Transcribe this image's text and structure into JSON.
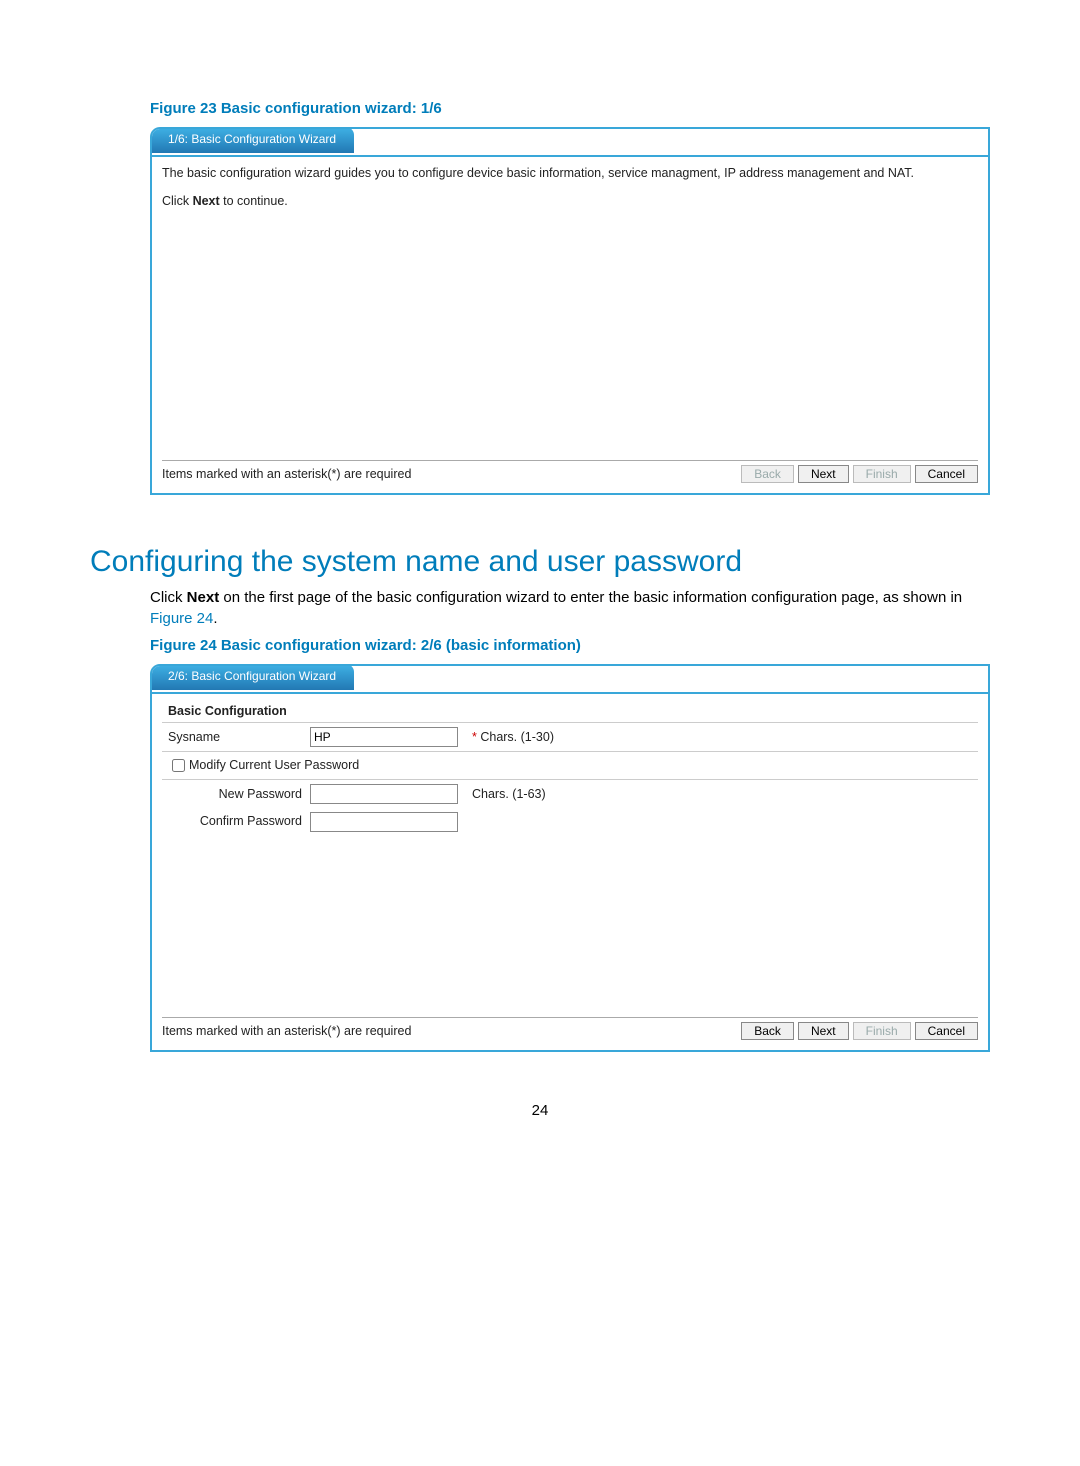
{
  "fig23": {
    "caption": "Figure 23 Basic configuration wizard: 1/6",
    "tab": "1/6: Basic Configuration Wizard",
    "intro": "The basic configuration wizard guides you to configure device basic information, service managment, IP address management and NAT.",
    "cont_pre": "Click ",
    "cont_bold": "Next",
    "cont_post": " to continue.",
    "req": "Items marked with an asterisk(*) are required",
    "btn_back": "Back",
    "btn_next": "Next",
    "btn_finish": "Finish",
    "btn_cancel": "Cancel"
  },
  "section": {
    "heading": "Configuring the system name and user password",
    "p_pre": "Click ",
    "p_bold": "Next",
    "p_mid": " on the first page of the basic configuration wizard to enter the basic information configuration page, as shown in ",
    "p_link": "Figure 24",
    "p_post": "."
  },
  "fig24": {
    "caption": "Figure 24 Basic configuration wizard: 2/6 (basic information)",
    "tab": "2/6: Basic Configuration Wizard",
    "hdr": "Basic Configuration",
    "sysname_label": "Sysname",
    "sysname_value": "HP",
    "sysname_hint": "Chars. (1-30)",
    "asterisk": "* ",
    "modify_label": "Modify Current User Password",
    "newpw_label": "New Password",
    "newpw_hint": "Chars. (1-63)",
    "confirm_label": "Confirm Password",
    "req": "Items marked with an asterisk(*) are required",
    "btn_back": "Back",
    "btn_next": "Next",
    "btn_finish": "Finish",
    "btn_cancel": "Cancel"
  },
  "page_number": "24"
}
